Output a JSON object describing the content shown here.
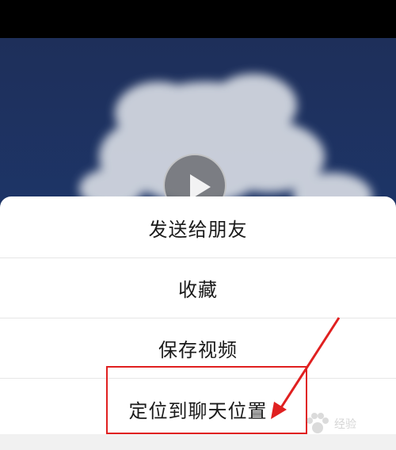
{
  "video": {
    "play_icon": "play-icon"
  },
  "menu": {
    "items": [
      {
        "label": "发送给朋友"
      },
      {
        "label": "收藏"
      },
      {
        "label": "保存视频"
      },
      {
        "label": "定位到聊天位置"
      }
    ]
  },
  "annotation": {
    "color": "#e02020"
  },
  "watermark": {
    "text": "经验"
  }
}
